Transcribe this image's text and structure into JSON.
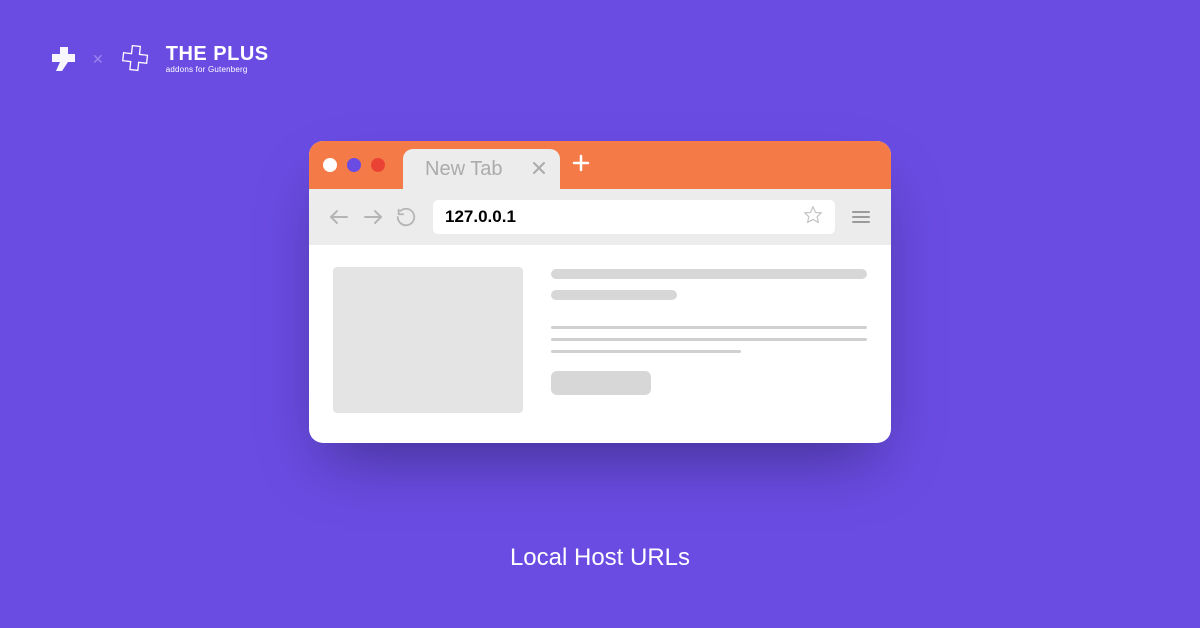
{
  "header": {
    "brand_title": "THE PLUS",
    "brand_subtitle": "addons for Gutenberg",
    "separator": "✕"
  },
  "browser": {
    "tab_label": "New Tab",
    "address": "127.0.0.1"
  },
  "caption": "Local Host URLs",
  "icons": {
    "close": "close-icon",
    "new_tab": "plus-icon",
    "back": "back-arrow-icon",
    "forward": "forward-arrow-icon",
    "reload": "reload-icon",
    "star": "star-icon",
    "menu": "hamburger-icon"
  }
}
